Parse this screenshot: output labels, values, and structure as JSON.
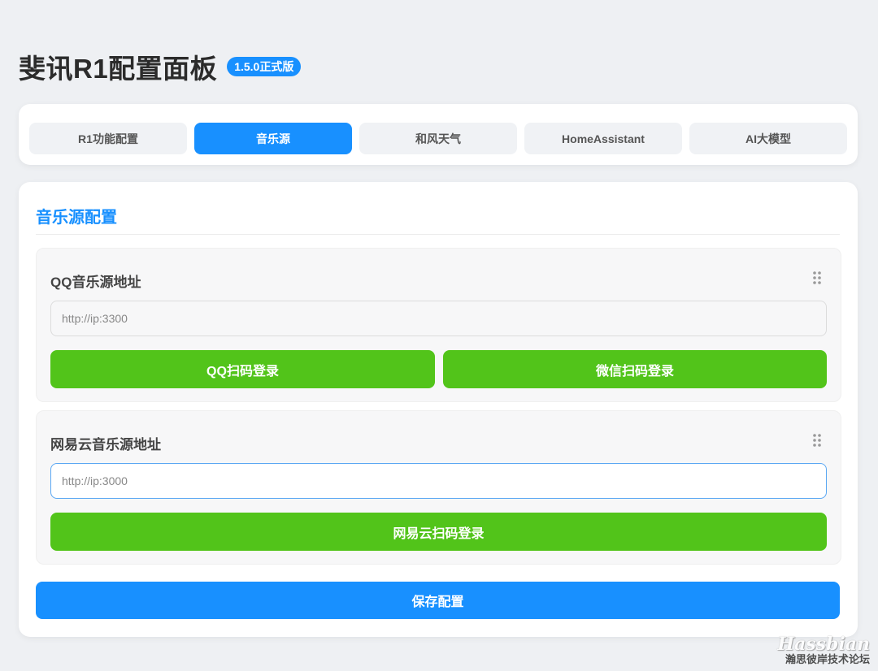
{
  "header": {
    "title": "斐讯R1配置面板",
    "version": "1.5.0正式版"
  },
  "tabs": [
    {
      "label": "R1功能配置",
      "active": false
    },
    {
      "label": "音乐源",
      "active": true
    },
    {
      "label": "和风天气",
      "active": false
    },
    {
      "label": "HomeAssistant",
      "active": false
    },
    {
      "label": "AI大模型",
      "active": false
    }
  ],
  "section": {
    "title": "音乐源配置"
  },
  "qq_group": {
    "label": "QQ音乐源地址",
    "input_placeholder": "http://ip:3300",
    "input_value": "",
    "buttons": {
      "qq_login": "QQ扫码登录",
      "wechat_login": "微信扫码登录"
    }
  },
  "netease_group": {
    "label": "网易云音乐源地址",
    "input_placeholder": "http://ip:3000",
    "input_value": "",
    "buttons": {
      "netease_login": "网易云扫码登录"
    }
  },
  "save_label": "保存配置",
  "watermark": {
    "logo": "Hassbian",
    "sub": "瀚思彼岸技术论坛"
  },
  "colors": {
    "primary": "#1890ff",
    "success": "#52c41a",
    "background": "#eef0f3"
  },
  "icons": {
    "drag_handle": "drag-handle-icon"
  }
}
